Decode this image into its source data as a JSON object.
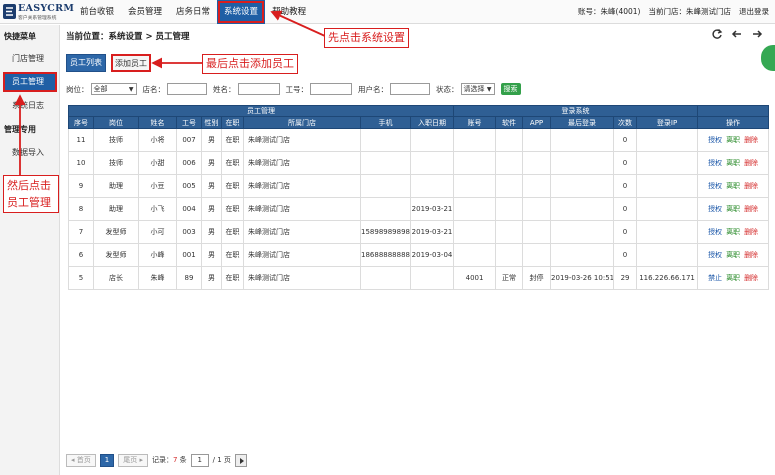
{
  "brand": {
    "name": "EASYCRM",
    "sub": "客户关系管理系统"
  },
  "nav": [
    {
      "label": "前台收银"
    },
    {
      "label": "会员管理"
    },
    {
      "label": "店务日常"
    },
    {
      "label": "系统设置"
    },
    {
      "label": "帮助教程"
    }
  ],
  "top_right": {
    "account": "账号：朱峰(4001)",
    "store": "当前门店：朱峰测试门店",
    "logout": "退出登录"
  },
  "sidebar": {
    "quick_menu": "快捷菜单",
    "store_manage": "门店管理",
    "staff_manage": "员工管理",
    "system_log": "系统日志",
    "manage_tools": "管理专用",
    "data_import": "数据导入"
  },
  "breadcrumb": "当前位置：系统设置 > 员工管理",
  "buttons": {
    "staff_list": "员工列表",
    "add_staff": "添加员工",
    "search": "搜索"
  },
  "filters": {
    "position_label": "岗位：",
    "position_value": "全部",
    "store_label": "店名：",
    "name_label": "姓名：",
    "number_label": "工号：",
    "username_label": "用户名：",
    "status_label": "状态：",
    "status_value": "请选择"
  },
  "table": {
    "group_staff": "员工管理",
    "group_login": "登录系统",
    "columns": [
      "序号",
      "岗位",
      "姓名",
      "工号",
      "性别",
      "在职",
      "所属门店",
      "手机",
      "入职日期",
      "账号",
      "软件",
      "APP",
      "最后登录",
      "次数",
      "登录IP",
      "操作"
    ],
    "rows": [
      {
        "seq": "11",
        "position": "技师",
        "name": "小将",
        "number": "007",
        "gender": "男",
        "status": "在职",
        "store": "朱峰测试门店",
        "phone": "",
        "join_date": "",
        "account": "",
        "software": "",
        "app": "",
        "last_login": "",
        "count": "0",
        "ip": "",
        "a1": "授权",
        "a2": "离职",
        "a3": "删除"
      },
      {
        "seq": "10",
        "position": "技师",
        "name": "小甜",
        "number": "006",
        "gender": "男",
        "status": "在职",
        "store": "朱峰测试门店",
        "phone": "",
        "join_date": "",
        "account": "",
        "software": "",
        "app": "",
        "last_login": "",
        "count": "0",
        "ip": "",
        "a1": "授权",
        "a2": "离职",
        "a3": "删除"
      },
      {
        "seq": "9",
        "position": "助理",
        "name": "小豆",
        "number": "005",
        "gender": "男",
        "status": "在职",
        "store": "朱峰测试门店",
        "phone": "",
        "join_date": "",
        "account": "",
        "software": "",
        "app": "",
        "last_login": "",
        "count": "0",
        "ip": "",
        "a1": "授权",
        "a2": "离职",
        "a3": "删除"
      },
      {
        "seq": "8",
        "position": "助理",
        "name": "小飞",
        "number": "004",
        "gender": "男",
        "status": "在职",
        "store": "朱峰测试门店",
        "phone": "",
        "join_date": "2019-03-21",
        "account": "",
        "software": "",
        "app": "",
        "last_login": "",
        "count": "0",
        "ip": "",
        "a1": "授权",
        "a2": "离职",
        "a3": "删除"
      },
      {
        "seq": "7",
        "position": "发型师",
        "name": "小可",
        "number": "003",
        "gender": "男",
        "status": "在职",
        "store": "朱峰测试门店",
        "phone": "15898989898",
        "join_date": "2019-03-21",
        "account": "",
        "software": "",
        "app": "",
        "last_login": "",
        "count": "0",
        "ip": "",
        "a1": "授权",
        "a2": "离职",
        "a3": "删除"
      },
      {
        "seq": "6",
        "position": "发型师",
        "name": "小峰",
        "number": "001",
        "gender": "男",
        "status": "在职",
        "store": "朱峰测试门店",
        "phone": "18688888888",
        "join_date": "2019-03-04",
        "account": "",
        "software": "",
        "app": "",
        "last_login": "",
        "count": "0",
        "ip": "",
        "a1": "授权",
        "a2": "离职",
        "a3": "删除"
      },
      {
        "seq": "5",
        "position": "店长",
        "name": "朱峰",
        "number": "89",
        "gender": "男",
        "status": "在职",
        "store": "朱峰测试门店",
        "phone": "",
        "join_date": "",
        "account": "4001",
        "software": "正常",
        "app": "封停",
        "last_login": "2019-03-26 10:51",
        "count": "29",
        "ip": "116.226.66.171",
        "a1": "禁止",
        "a2": "离职",
        "a3": "删除"
      }
    ]
  },
  "pager": {
    "first": "首页",
    "current": "1",
    "last": "尾页",
    "records_prefix": "记录：",
    "records_count": "7",
    "records_unit": "条",
    "page_input": "1",
    "page_total": "/ 1 页"
  },
  "notes": {
    "step1": "先点击系统设置",
    "step2": "然后点击员工管理",
    "step3": "最后点击添加员工"
  },
  "colors": {
    "primary": "#1f5fa5",
    "header": "#2f5f94",
    "annotation": "#d81e1e",
    "search": "#33a04a"
  }
}
